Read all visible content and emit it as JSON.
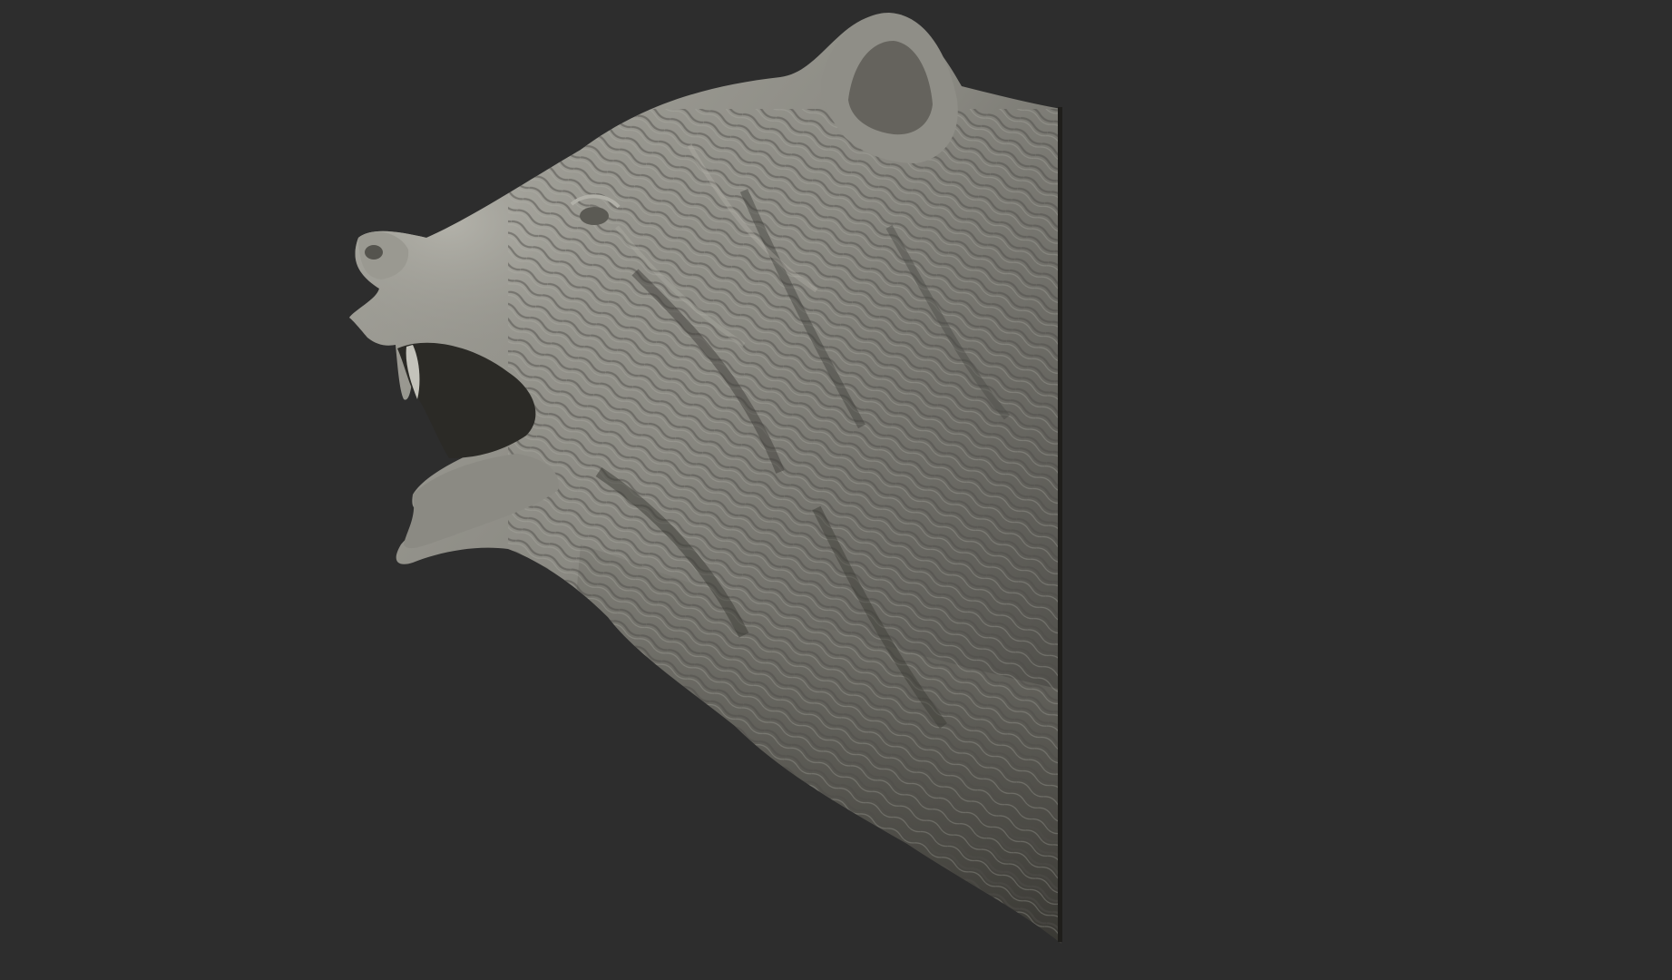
{
  "scene": {
    "subject_icon": "sculpt-model-icon",
    "colors": {
      "background": "#2d2d2d",
      "clay_light": "#a3a29a",
      "clay_mid": "#7c7b74",
      "clay_dark": "#3c3b37",
      "clay_shadow": "#26251f"
    }
  }
}
